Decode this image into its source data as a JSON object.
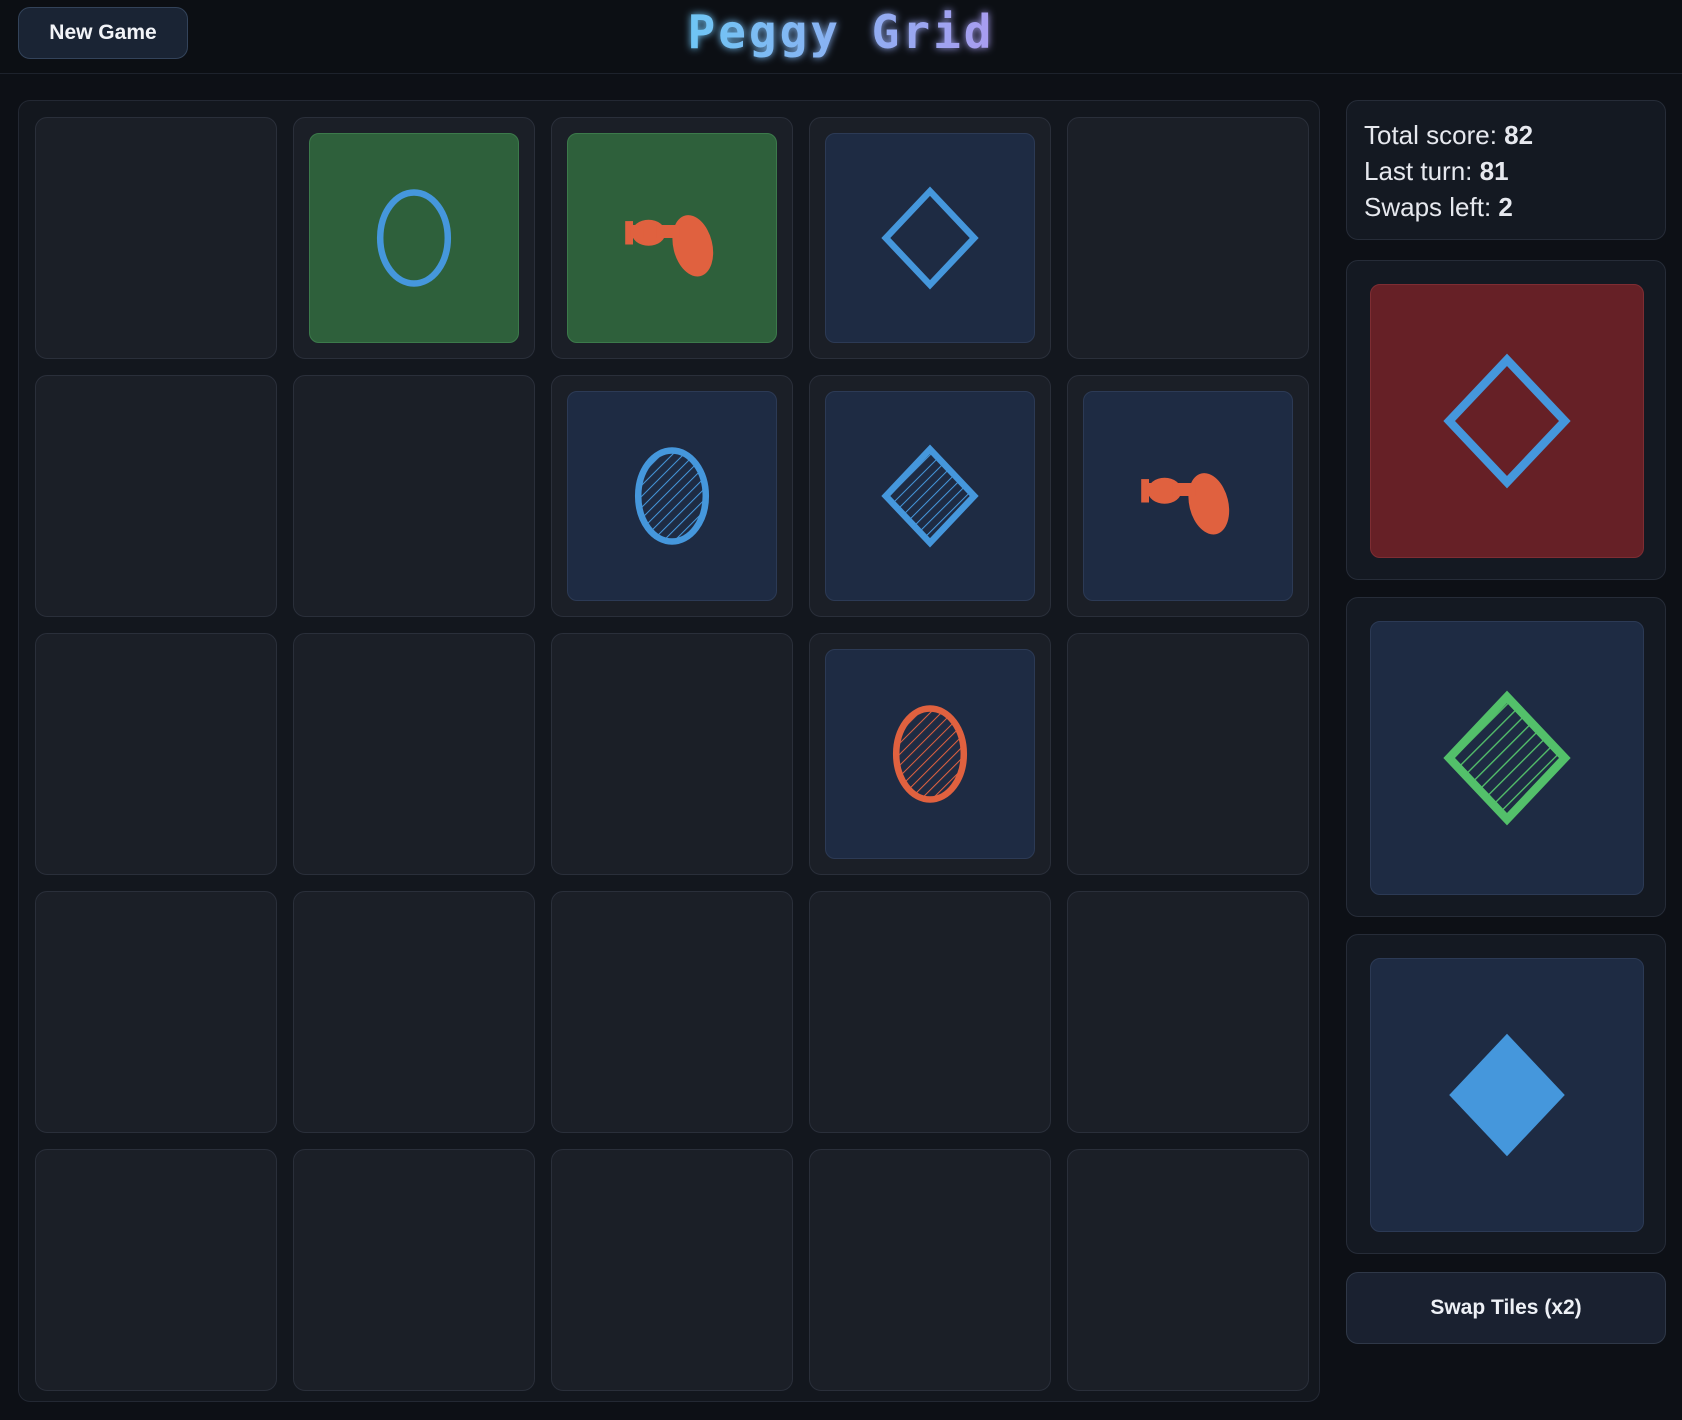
{
  "header": {
    "new_game_label": "New Game",
    "title": "Peggy Grid",
    "title_gradient": [
      "#6ec6f5",
      "#a99cf0"
    ]
  },
  "colors": {
    "blue": "#4597dc",
    "orange": "#e0613f",
    "green": "#53c06a",
    "tile_dark": "#1e2b43",
    "tile_green": "#2e603b",
    "tile_red": "#662026"
  },
  "board": {
    "rows": 5,
    "cols": 5,
    "tiles": [
      {
        "row": 0,
        "col": 1,
        "shape": "oval",
        "color": "blue",
        "fill": "outline",
        "bg": "tile_green"
      },
      {
        "row": 0,
        "col": 2,
        "shape": "peanut",
        "color": "orange",
        "fill": "solid",
        "bg": "tile_green"
      },
      {
        "row": 0,
        "col": 3,
        "shape": "diamond",
        "color": "blue",
        "fill": "outline",
        "bg": "tile_dark"
      },
      {
        "row": 1,
        "col": 2,
        "shape": "oval",
        "color": "blue",
        "fill": "striped",
        "bg": "tile_dark"
      },
      {
        "row": 1,
        "col": 3,
        "shape": "diamond",
        "color": "blue",
        "fill": "striped",
        "bg": "tile_dark"
      },
      {
        "row": 1,
        "col": 4,
        "shape": "peanut",
        "color": "orange",
        "fill": "solid",
        "bg": "tile_dark"
      },
      {
        "row": 2,
        "col": 3,
        "shape": "oval",
        "color": "orange",
        "fill": "striped",
        "bg": "tile_dark"
      }
    ]
  },
  "score": {
    "total_label": "Total score: ",
    "total_value": "82",
    "last_label": "Last turn: ",
    "last_value": "81",
    "swaps_label": "Swaps left: ",
    "swaps_value": "2"
  },
  "hand": [
    {
      "shape": "diamond",
      "color": "blue",
      "fill": "outline",
      "bg": "tile_red",
      "selected": true
    },
    {
      "shape": "diamond",
      "color": "green",
      "fill": "striped",
      "bg": "tile_dark",
      "selected": false
    },
    {
      "shape": "diamond",
      "color": "blue",
      "fill": "solid",
      "bg": "tile_dark",
      "selected": false
    }
  ],
  "swap_label": "Swap Tiles (x2)"
}
